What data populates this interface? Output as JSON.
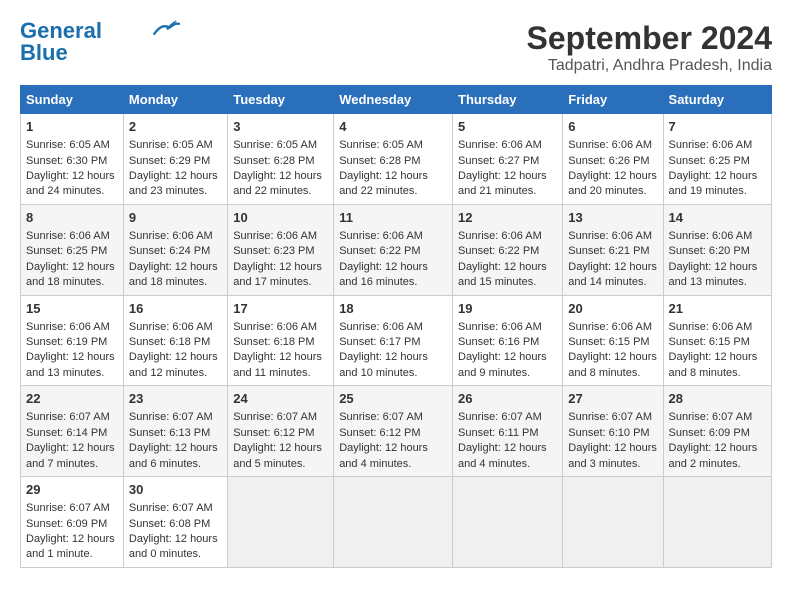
{
  "logo": {
    "line1": "General",
    "line2": "Blue"
  },
  "title": "September 2024",
  "subtitle": "Tadpatri, Andhra Pradesh, India",
  "days_of_week": [
    "Sunday",
    "Monday",
    "Tuesday",
    "Wednesday",
    "Thursday",
    "Friday",
    "Saturday"
  ],
  "weeks": [
    [
      {
        "day": "1",
        "sunrise": "6:05 AM",
        "sunset": "6:30 PM",
        "daylight": "12 hours and 24 minutes."
      },
      {
        "day": "2",
        "sunrise": "6:05 AM",
        "sunset": "6:29 PM",
        "daylight": "12 hours and 23 minutes."
      },
      {
        "day": "3",
        "sunrise": "6:05 AM",
        "sunset": "6:28 PM",
        "daylight": "12 hours and 22 minutes."
      },
      {
        "day": "4",
        "sunrise": "6:05 AM",
        "sunset": "6:28 PM",
        "daylight": "12 hours and 22 minutes."
      },
      {
        "day": "5",
        "sunrise": "6:06 AM",
        "sunset": "6:27 PM",
        "daylight": "12 hours and 21 minutes."
      },
      {
        "day": "6",
        "sunrise": "6:06 AM",
        "sunset": "6:26 PM",
        "daylight": "12 hours and 20 minutes."
      },
      {
        "day": "7",
        "sunrise": "6:06 AM",
        "sunset": "6:25 PM",
        "daylight": "12 hours and 19 minutes."
      }
    ],
    [
      {
        "day": "8",
        "sunrise": "6:06 AM",
        "sunset": "6:25 PM",
        "daylight": "12 hours and 18 minutes."
      },
      {
        "day": "9",
        "sunrise": "6:06 AM",
        "sunset": "6:24 PM",
        "daylight": "12 hours and 18 minutes."
      },
      {
        "day": "10",
        "sunrise": "6:06 AM",
        "sunset": "6:23 PM",
        "daylight": "12 hours and 17 minutes."
      },
      {
        "day": "11",
        "sunrise": "6:06 AM",
        "sunset": "6:22 PM",
        "daylight": "12 hours and 16 minutes."
      },
      {
        "day": "12",
        "sunrise": "6:06 AM",
        "sunset": "6:22 PM",
        "daylight": "12 hours and 15 minutes."
      },
      {
        "day": "13",
        "sunrise": "6:06 AM",
        "sunset": "6:21 PM",
        "daylight": "12 hours and 14 minutes."
      },
      {
        "day": "14",
        "sunrise": "6:06 AM",
        "sunset": "6:20 PM",
        "daylight": "12 hours and 13 minutes."
      }
    ],
    [
      {
        "day": "15",
        "sunrise": "6:06 AM",
        "sunset": "6:19 PM",
        "daylight": "12 hours and 13 minutes."
      },
      {
        "day": "16",
        "sunrise": "6:06 AM",
        "sunset": "6:18 PM",
        "daylight": "12 hours and 12 minutes."
      },
      {
        "day": "17",
        "sunrise": "6:06 AM",
        "sunset": "6:18 PM",
        "daylight": "12 hours and 11 minutes."
      },
      {
        "day": "18",
        "sunrise": "6:06 AM",
        "sunset": "6:17 PM",
        "daylight": "12 hours and 10 minutes."
      },
      {
        "day": "19",
        "sunrise": "6:06 AM",
        "sunset": "6:16 PM",
        "daylight": "12 hours and 9 minutes."
      },
      {
        "day": "20",
        "sunrise": "6:06 AM",
        "sunset": "6:15 PM",
        "daylight": "12 hours and 8 minutes."
      },
      {
        "day": "21",
        "sunrise": "6:06 AM",
        "sunset": "6:15 PM",
        "daylight": "12 hours and 8 minutes."
      }
    ],
    [
      {
        "day": "22",
        "sunrise": "6:07 AM",
        "sunset": "6:14 PM",
        "daylight": "12 hours and 7 minutes."
      },
      {
        "day": "23",
        "sunrise": "6:07 AM",
        "sunset": "6:13 PM",
        "daylight": "12 hours and 6 minutes."
      },
      {
        "day": "24",
        "sunrise": "6:07 AM",
        "sunset": "6:12 PM",
        "daylight": "12 hours and 5 minutes."
      },
      {
        "day": "25",
        "sunrise": "6:07 AM",
        "sunset": "6:12 PM",
        "daylight": "12 hours and 4 minutes."
      },
      {
        "day": "26",
        "sunrise": "6:07 AM",
        "sunset": "6:11 PM",
        "daylight": "12 hours and 4 minutes."
      },
      {
        "day": "27",
        "sunrise": "6:07 AM",
        "sunset": "6:10 PM",
        "daylight": "12 hours and 3 minutes."
      },
      {
        "day": "28",
        "sunrise": "6:07 AM",
        "sunset": "6:09 PM",
        "daylight": "12 hours and 2 minutes."
      }
    ],
    [
      {
        "day": "29",
        "sunrise": "6:07 AM",
        "sunset": "6:09 PM",
        "daylight": "12 hours and 1 minute."
      },
      {
        "day": "30",
        "sunrise": "6:07 AM",
        "sunset": "6:08 PM",
        "daylight": "12 hours and 0 minutes."
      },
      null,
      null,
      null,
      null,
      null
    ]
  ]
}
